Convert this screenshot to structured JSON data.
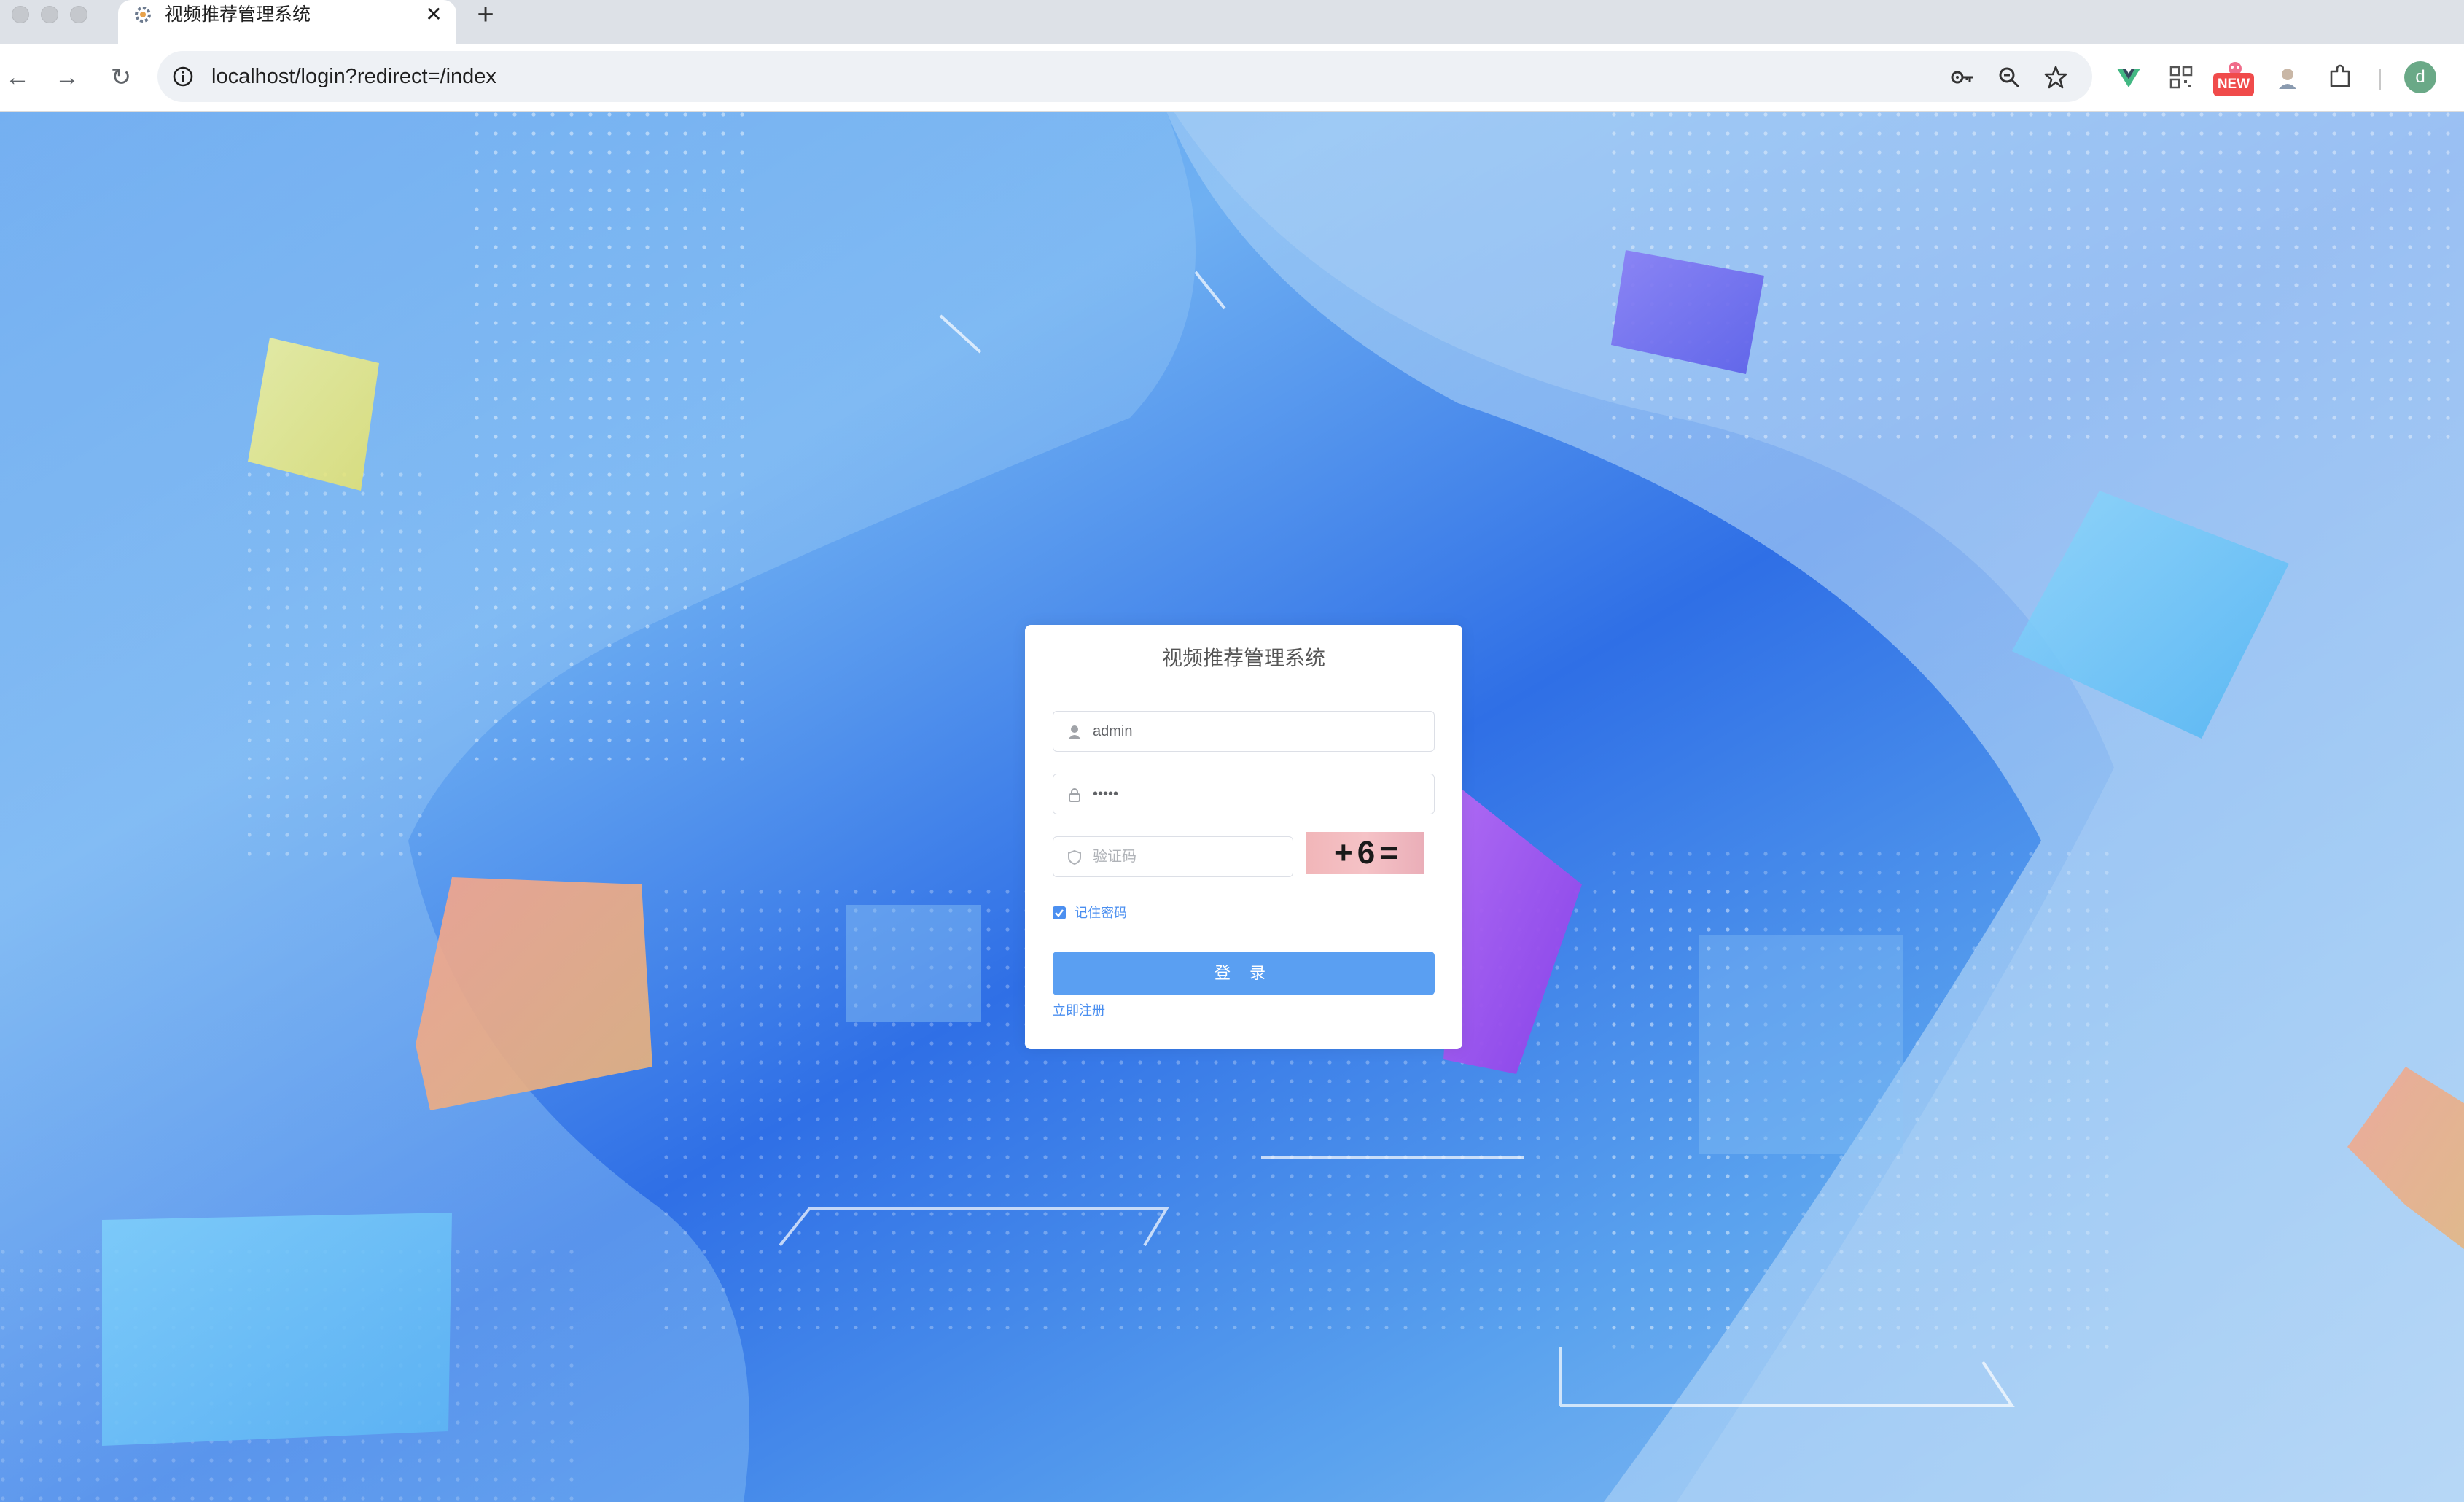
{
  "browser": {
    "tab": {
      "title": "视频推荐管理系统",
      "close_glyph": "✕",
      "favicon": "gear-favicon-icon"
    },
    "new_tab_glyph": "+",
    "nav": {
      "back": "←",
      "forward": "→",
      "reload": "↻"
    },
    "url": "localhost/login?redirect=/index",
    "omnibox_icons": [
      "key-icon",
      "zoom-icon",
      "star-icon"
    ],
    "extensions": [
      "vue-devtools-icon",
      "qr-code-icon",
      "new-extension-icon",
      "profile-extension-icon",
      "puzzle-icon"
    ],
    "new_badge": "NEW",
    "profile_initial": "d"
  },
  "login": {
    "title": "视频推荐管理系统",
    "username": {
      "value": "admin",
      "icon": "user-icon"
    },
    "password": {
      "value": "•••••",
      "icon": "lock-icon"
    },
    "captcha": {
      "placeholder": "验证码",
      "icon": "shield-icon",
      "image_text": "+6="
    },
    "remember": {
      "label": "记住密码",
      "checked": true
    },
    "submit_label": "登 录",
    "register_link": "立即注册"
  },
  "colors": {
    "accent": "#5a9ff2",
    "link": "#4b8ff0",
    "background_blue": "#2f6fe6"
  }
}
